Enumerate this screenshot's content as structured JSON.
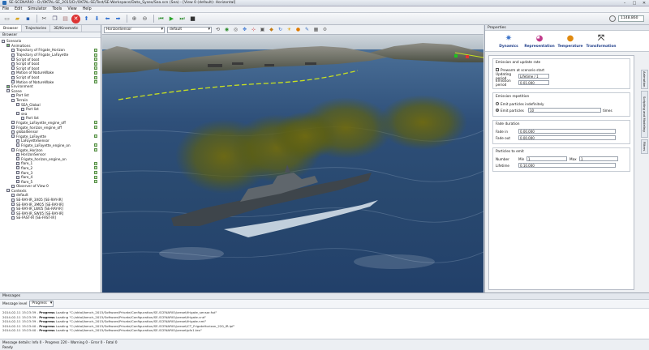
{
  "window": {
    "title": "SE-SCENARIO - D:/OKTAL-SE_2015/D:/OKTAL-SE/Test/SE-Workspace/Data_Sysex/Sea.scn (Sea) - [View 0 (default): Horizontal]"
  },
  "menu": [
    "File",
    "Edit",
    "Simulator",
    "Tools",
    "View",
    "Help"
  ],
  "time": {
    "value": "1148.860"
  },
  "left_panel": {
    "tabs": [
      "Browser",
      "Trajectories",
      "3D/Kinematic"
    ],
    "header": "Browser",
    "tree": [
      {
        "label": "Scenario",
        "d": 0,
        "g": false,
        "c": false
      },
      {
        "label": "Animations",
        "d": 1,
        "g": true,
        "c": false
      },
      {
        "label": "Trajectory of Frigate_Horizon",
        "d": 2,
        "g": false,
        "c": true
      },
      {
        "label": "Trajectory of Frigate_LaFayette",
        "d": 2,
        "g": false,
        "c": true
      },
      {
        "label": "Script of boat",
        "d": 2,
        "g": false,
        "c": true
      },
      {
        "label": "Script of boat",
        "d": 2,
        "g": false,
        "c": true
      },
      {
        "label": "Script of boat",
        "d": 2,
        "g": false,
        "c": true
      },
      {
        "label": "Motion of NatureWake",
        "d": 2,
        "g": false,
        "c": true
      },
      {
        "label": "Script of boat",
        "d": 2,
        "g": false,
        "c": true
      },
      {
        "label": "Motion of NatureWake",
        "d": 2,
        "g": false,
        "c": true
      },
      {
        "label": "Environment",
        "d": 1,
        "g": true,
        "c": false
      },
      {
        "label": "Scene",
        "d": 1,
        "g": false,
        "c": false
      },
      {
        "label": "Part list",
        "d": 2,
        "g": false,
        "c": false
      },
      {
        "label": "Terrain",
        "d": 2,
        "g": false,
        "c": false
      },
      {
        "label": "SEA_Global",
        "d": 3,
        "g": false,
        "c": false
      },
      {
        "label": "Part list",
        "d": 4,
        "g": false,
        "c": false
      },
      {
        "label": "sea",
        "d": 3,
        "g": false,
        "c": false
      },
      {
        "label": "Part list",
        "d": 4,
        "g": false,
        "c": false
      },
      {
        "label": "Frigate_LaFayette_engine_off",
        "d": 2,
        "g": false,
        "c": true
      },
      {
        "label": "Frigate_horizon_engine_off",
        "d": 2,
        "g": false,
        "c": true
      },
      {
        "label": "globalSensor",
        "d": 2,
        "g": false,
        "c": false
      },
      {
        "label": "Frigate_LaFayette",
        "d": 2,
        "g": false,
        "c": true
      },
      {
        "label": "LaFayetteSensor",
        "d": 3,
        "g": false,
        "c": false
      },
      {
        "label": "Frigate_LaFayette_engine_on",
        "d": 3,
        "g": false,
        "c": true
      },
      {
        "label": "Frigate_Horizon",
        "d": 2,
        "g": false,
        "c": true
      },
      {
        "label": "HorizonSensor",
        "d": 3,
        "g": false,
        "c": false
      },
      {
        "label": "Frigate_horizon_engine_on",
        "d": 3,
        "g": false,
        "c": false
      },
      {
        "label": "flare_1",
        "d": 3,
        "g": false,
        "c": true
      },
      {
        "label": "flare_2",
        "d": 3,
        "g": false,
        "c": true
      },
      {
        "label": "flare_3",
        "d": 3,
        "g": false,
        "c": true
      },
      {
        "label": "flare_4",
        "d": 3,
        "g": false,
        "c": true
      },
      {
        "label": "flare_5",
        "d": 3,
        "g": false,
        "c": true
      },
      {
        "label": "Observer of View 0",
        "d": 2,
        "g": false,
        "c": false
      },
      {
        "label": "Contexts",
        "d": 1,
        "g": false,
        "c": false
      },
      {
        "label": "default",
        "d": 2,
        "g": false,
        "c": false
      },
      {
        "label": "SE-RAY-IR_3X05 [SE-RAY-IR]",
        "d": 2,
        "g": false,
        "c": false
      },
      {
        "label": "SE-RAY-IR_3MO5 [SE-RAY-IR]",
        "d": 2,
        "g": false,
        "c": false
      },
      {
        "label": "SE-RAY-IR_LW05 [SE-RAY-IR]",
        "d": 2,
        "g": false,
        "c": false
      },
      {
        "label": "SE-RAY-IR_SW05 [SE-RAY-IR]",
        "d": 2,
        "g": false,
        "c": false
      },
      {
        "label": "SE-FAST-IR [SE-FAST-IR]",
        "d": 2,
        "g": false,
        "c": false
      }
    ]
  },
  "view_toolbar": {
    "sensor": "HorizonSensor",
    "context": "default"
  },
  "properties": {
    "header": "Properties",
    "tabs": [
      "Dynamics",
      "Representation",
      "Temperature",
      "Transformation"
    ],
    "emission": {
      "title": "Emission and update rate",
      "prewarm": "Prewarm at scenario start",
      "updating_label": "Updating period",
      "updating_mode": "Lifetime / 1",
      "emission_label": "Emission period",
      "emission_value": "0.01.000"
    },
    "repetition": {
      "title": "Emission repetition",
      "opt1": "Emit particles indefinitely",
      "opt2": "Emit particles",
      "count": "10",
      "unit": "times"
    },
    "fade": {
      "title": "Fade duration",
      "in_label": "Fade in",
      "in_value": "0.00.000",
      "out_label": "Fade out",
      "out_value": "0.00.000"
    },
    "particles": {
      "title": "Particles to emit",
      "number_label": "Number",
      "min_label": "Min",
      "min_value": "1",
      "max_label": "Max",
      "max_value": "1",
      "lifetime_label": "Lifetime",
      "lifetime_value": "0.10.000"
    },
    "side_tabs": [
      "Animation",
      "Scripting and Modeling",
      "Filters"
    ]
  },
  "messages": {
    "header": "Messages",
    "level_label": "Message level",
    "level": "Progress",
    "lines": [
      {
        "t": "2014-02-11 15:23:39 - ",
        "k": "Progress",
        "m": "Loading \"C:/oktal/bench_2015/Software/Private/Configuration/SE-SCENARIO/preset/frigate_sensor.fsd\""
      },
      {
        "t": "2014-02-11 15:23:39 - ",
        "k": "Progress",
        "m": "Loading \"C:/oktal/bench_2015/Software/Private/Configuration/SE-SCENARIO/preset/frigate.cnd\""
      },
      {
        "t": "2014-02-11 15:23:39 - ",
        "k": "Progress",
        "m": "Loading \"C:/oktal/bench_2015/Software/Private/Configuration/SE-SCENARIO/preset/frigate.nml\""
      },
      {
        "t": "2014-02-11 15:23:40 - ",
        "k": "Progress",
        "m": "Loading \"C:/oktal/bench_2015/Software/Private/Configuration/SE-SCENARIO/preset/CT_FrigateHorizon_220_IR.ipf\""
      },
      {
        "t": "2014-02-11 15:23:40 - ",
        "k": "Progress",
        "m": "Loading \"C:/oktal/bench_2015/Software/Private/Configuration/SE-SCENARIO/preset/pfx1.tex\""
      }
    ],
    "status_summary": "Message details: Info 0 - Progress 220 - Warning 0 - Error 0 - Fatal 0",
    "ready": "Ready"
  }
}
